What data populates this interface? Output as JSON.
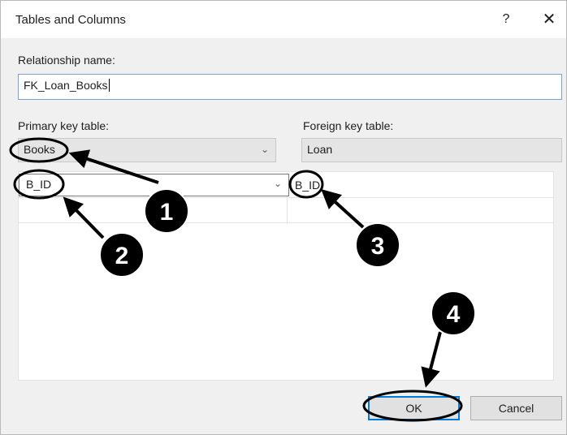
{
  "dialog": {
    "title": "Tables and Columns",
    "help_glyph": "?",
    "close_glyph": "✕"
  },
  "relationship": {
    "label": "Relationship name:",
    "value": "FK_Loan_Books"
  },
  "primary_key": {
    "label": "Primary key table:",
    "table": "Books",
    "column": "B_ID"
  },
  "foreign_key": {
    "label": "Foreign key table:",
    "table": "Loan",
    "column": "B_ID"
  },
  "buttons": {
    "ok": "OK",
    "cancel": "Cancel"
  },
  "annotations": {
    "step1": "1",
    "step2": "2",
    "step3": "3",
    "step4": "4"
  },
  "icons": {
    "dropdown": "chevron-down-icon",
    "close": "close-icon",
    "help": "help-icon"
  }
}
